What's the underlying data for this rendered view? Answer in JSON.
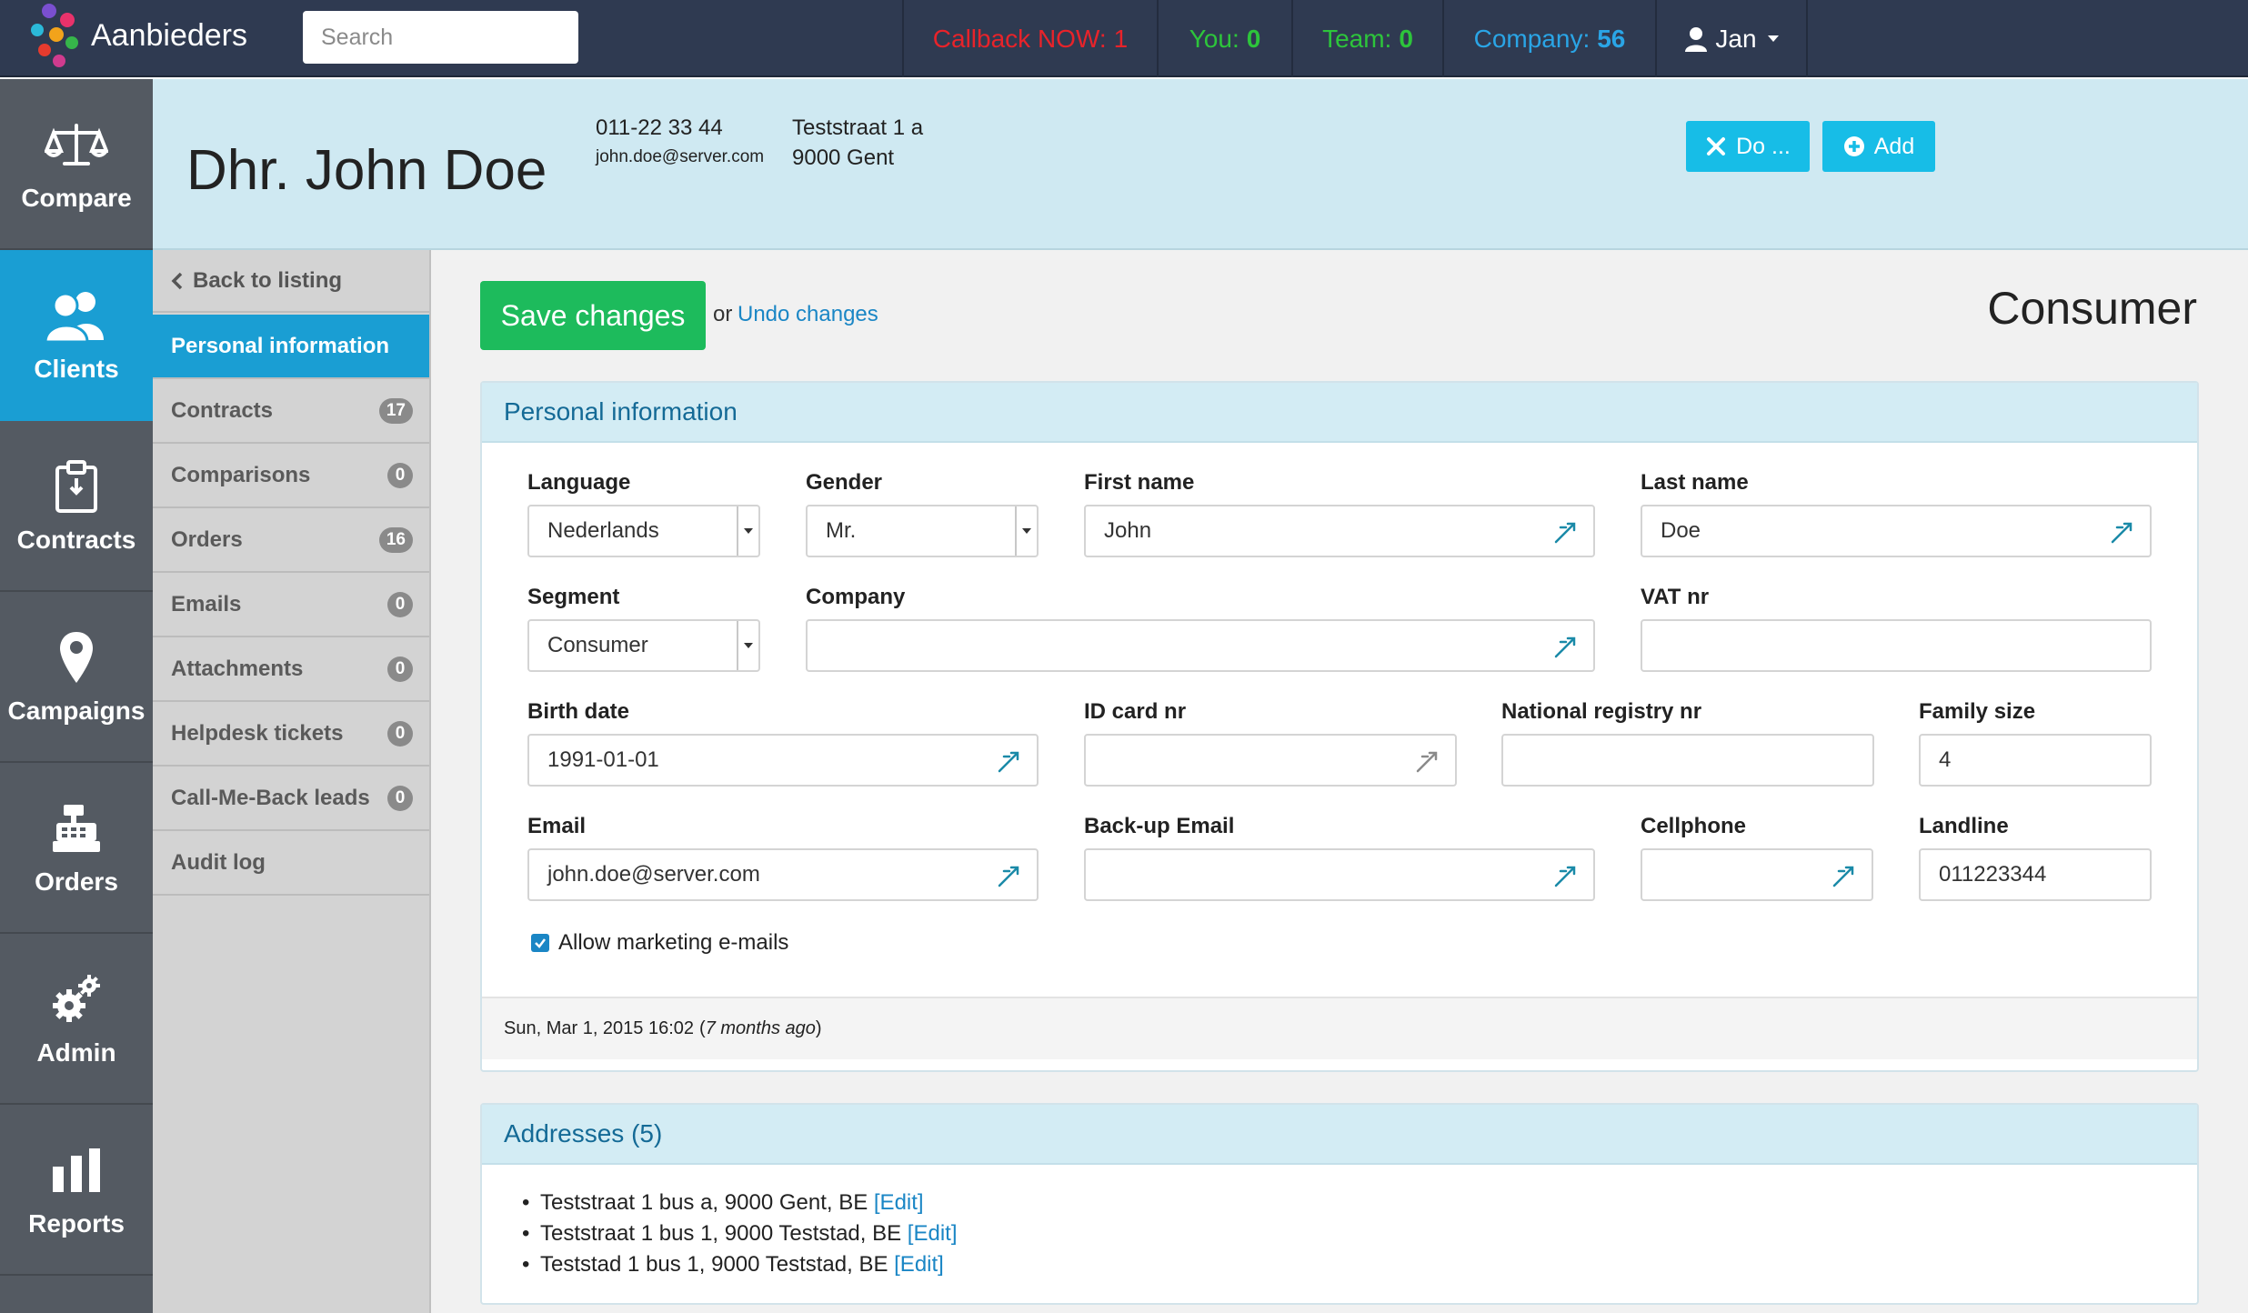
{
  "app": {
    "brand": "Aanbieders"
  },
  "search": {
    "placeholder": "Search"
  },
  "stats": {
    "callback": {
      "label": "Callback NOW:",
      "value": "1",
      "color": "#e8232a"
    },
    "you": {
      "label": "You:",
      "value": "0",
      "color": "#2dc53b"
    },
    "team": {
      "label": "Team:",
      "value": "0",
      "color": "#2dc53b"
    },
    "company": {
      "label": "Company:",
      "value": "56",
      "color": "#2aa5e6"
    }
  },
  "user": {
    "name": "Jan"
  },
  "mainnav": [
    {
      "label": "Compare",
      "icon": "scales-icon"
    },
    {
      "label": "Clients",
      "icon": "users-icon"
    },
    {
      "label": "Contracts",
      "icon": "clipboard-icon"
    },
    {
      "label": "Campaigns",
      "icon": "map-pin-icon"
    },
    {
      "label": "Orders",
      "icon": "cash-register-icon"
    },
    {
      "label": "Admin",
      "icon": "gears-icon"
    },
    {
      "label": "Reports",
      "icon": "bar-chart-icon"
    }
  ],
  "client": {
    "name": "Dhr. John Doe",
    "phone": "011-22 33 44",
    "email": "john.doe@server.com",
    "street": "Teststraat 1 a",
    "city": "9000 Gent"
  },
  "actions": {
    "do_label": "Do ...",
    "add_label": "Add"
  },
  "subnav": {
    "back": "Back to listing",
    "items": [
      {
        "label": "Personal information"
      },
      {
        "label": "Contracts",
        "badge": "17"
      },
      {
        "label": "Comparisons",
        "badge": "0"
      },
      {
        "label": "Orders",
        "badge": "16"
      },
      {
        "label": "Emails",
        "badge": "0"
      },
      {
        "label": "Attachments",
        "badge": "0"
      },
      {
        "label": "Helpdesk tickets",
        "badge": "0"
      },
      {
        "label": "Call-Me-Back leads",
        "badge": "0"
      },
      {
        "label": "Audit log"
      }
    ]
  },
  "form": {
    "save_label": "Save changes",
    "or_text": "or",
    "undo_label": "Undo changes",
    "page_type": "Consumer",
    "panel_title": "Personal information",
    "fields": {
      "language": {
        "label": "Language",
        "value": "Nederlands"
      },
      "gender": {
        "label": "Gender",
        "value": "Mr."
      },
      "first_name": {
        "label": "First name",
        "value": "John"
      },
      "last_name": {
        "label": "Last name",
        "value": "Doe"
      },
      "segment": {
        "label": "Segment",
        "value": "Consumer"
      },
      "company": {
        "label": "Company",
        "value": ""
      },
      "vat": {
        "label": "VAT nr",
        "value": ""
      },
      "birth_date": {
        "label": "Birth date",
        "value": "1991-01-01"
      },
      "id_card": {
        "label": "ID card nr",
        "value": ""
      },
      "national_registry": {
        "label": "National registry nr",
        "value": ""
      },
      "family_size": {
        "label": "Family size",
        "value": "4"
      },
      "email": {
        "label": "Email",
        "value": "john.doe@server.com"
      },
      "backup_email": {
        "label": "Back-up Email",
        "value": ""
      },
      "cellphone": {
        "label": "Cellphone",
        "value": ""
      },
      "landline": {
        "label": "Landline",
        "value": "011223344"
      }
    },
    "allow_marketing_label": "Allow marketing e-mails",
    "allow_marketing_checked": true,
    "footer_date": "Sun, Mar 1, 2015 16:02",
    "footer_relative": "7 months ago"
  },
  "addresses": {
    "title": "Addresses (5)",
    "edit_label": "[Edit]",
    "items": [
      "Teststraat 1 bus a, 9000 Gent, BE",
      "Teststraat 1 bus 1, 9000 Teststad, BE",
      "Teststad 1 bus 1, 9000 Teststad, BE"
    ]
  },
  "colors": {
    "accent": "#1a9ed3",
    "save": "#1dbb5c",
    "nav_bg": "#2f3a51",
    "header_bg": "#cfe9f2",
    "link": "#1a86c5"
  }
}
